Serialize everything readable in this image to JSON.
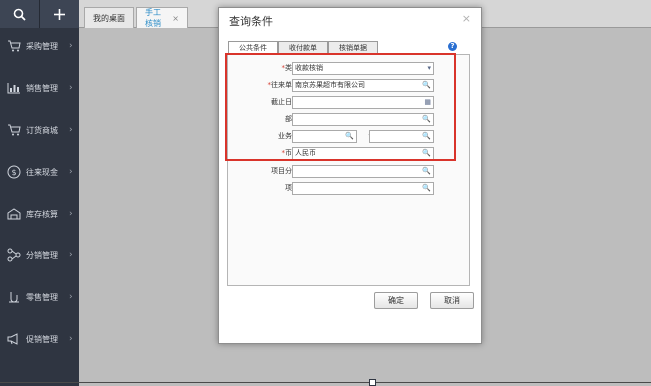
{
  "topbar": {
    "search_icon": "search-icon",
    "add_icon": "plus-icon"
  },
  "sidebar": {
    "items": [
      {
        "label": "采购管理",
        "icon": "cart-icon"
      },
      {
        "label": "销售管理",
        "icon": "chart-icon"
      },
      {
        "label": "订货商城",
        "icon": "cart-icon"
      },
      {
        "label": "往来现金",
        "icon": "dollar-icon"
      },
      {
        "label": "库存核算",
        "icon": "warehouse-icon"
      },
      {
        "label": "分销管理",
        "icon": "distribution-icon"
      },
      {
        "label": "零售管理",
        "icon": "retail-icon"
      },
      {
        "label": "促销管理",
        "icon": "megaphone-icon"
      }
    ],
    "arrow": "›"
  },
  "tabs": [
    {
      "label": "我的桌面"
    },
    {
      "label": "手工核销",
      "close": "×"
    }
  ],
  "dialog": {
    "title": "查询条件",
    "close": "×",
    "tabs": [
      "公共条件",
      "收付款单",
      "核销单据"
    ],
    "help": "?",
    "fields": {
      "type": {
        "label": "类型",
        "required": "*",
        "value": "收款核销",
        "icon": "▾"
      },
      "partner": {
        "label": "往来单位",
        "required": "*",
        "value": "南京苏果超市有限公司",
        "icon": "🔍"
      },
      "deadline": {
        "label": "截止日期",
        "value": "",
        "icon": "▦"
      },
      "dept": {
        "label": "部门",
        "value": "",
        "icon": "🔍"
      },
      "salesman": {
        "label": "业务员",
        "value_from": "",
        "value_to": "",
        "separator": "~",
        "icon": "🔍"
      },
      "currency": {
        "label": "币种",
        "required": "*",
        "value": "人民币",
        "icon": "🔍"
      },
      "project_cat": {
        "label": "项目分类",
        "value": "",
        "icon": "🔍"
      },
      "project": {
        "label": "项目",
        "value": "",
        "icon": "🔍"
      }
    },
    "buttons": {
      "ok": "确定",
      "cancel": "取消"
    }
  }
}
